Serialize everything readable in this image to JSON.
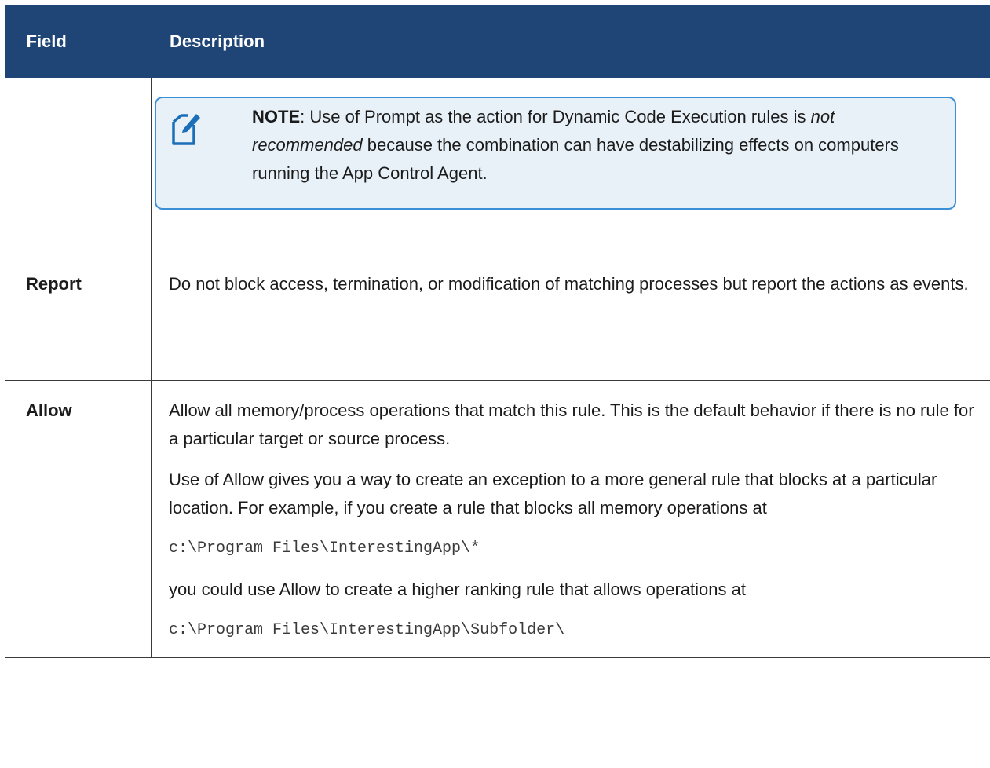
{
  "table": {
    "headers": [
      "Field",
      "Description"
    ],
    "note": {
      "label": "NOTE",
      "sep": ": Use of Prompt as the action for Dynamic Code Execution rules is ",
      "emph": "not recommended",
      "rest": " because the combination can have destabilizing effects on computers running the App Control Agent."
    },
    "report": {
      "field": "Report",
      "description": "Do not block access, termination, or modification of matching processes but report the actions as events."
    },
    "allow": {
      "field": "Allow",
      "p1": "Allow all memory/process operations that match this rule. This is the default behavior if there is no rule for a particular target or source process.",
      "p2": "Use of Allow gives you a way to create an exception to a more general rule that blocks at a particular location. For example, if you create a rule that blocks all memory operations at",
      "code1": "c:\\Program Files\\InterestingApp\\*",
      "p3": "you could use Allow to create a higher ranking rule that allows operations at",
      "code2": "c:\\Program Files\\InterestingApp\\Subfolder\\"
    }
  },
  "colors": {
    "header_bg": "#1f4576",
    "note_border": "#3a8fd6",
    "note_bg": "#e8f1f8"
  },
  "icons": {
    "note": "note-pencil-icon"
  }
}
